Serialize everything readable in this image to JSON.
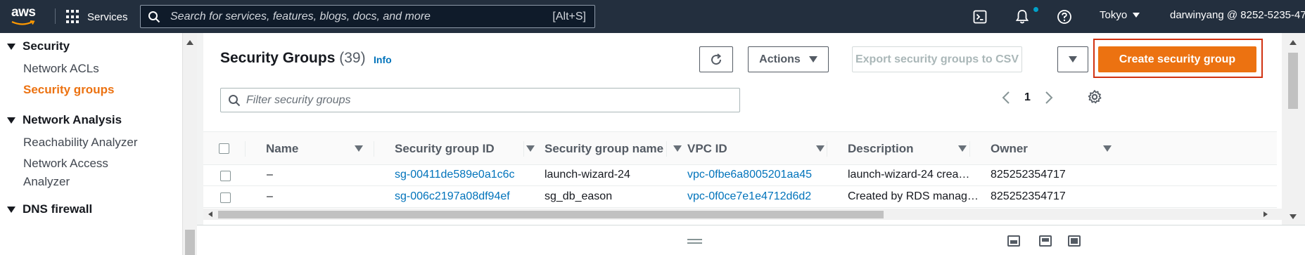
{
  "topnav": {
    "logo_text": "aws",
    "services_label": "Services",
    "search_placeholder": "Search for services, features, blogs, docs, and more",
    "search_shortcut": "[Alt+S]",
    "region": "Tokyo",
    "account": "darwinyang @ 8252-5235-47",
    "notification_dot_color": "#00a1c9"
  },
  "sidebar": {
    "sections": [
      {
        "label": "Security",
        "items": [
          "Network ACLs",
          "Security groups"
        ]
      },
      {
        "label": "Network Analysis",
        "items": [
          "Reachability Analyzer",
          "Network Access Analyzer"
        ]
      },
      {
        "label": "DNS firewall",
        "items": []
      }
    ],
    "active_item": "Security groups"
  },
  "main": {
    "title": "Security Groups",
    "count": "(39)",
    "info_label": "Info",
    "actions_label": "Actions",
    "export_label": "Export security groups to CSV",
    "create_label": "Create security group",
    "filter_placeholder": "Filter security groups",
    "page_number": "1",
    "columns": [
      "Name",
      "Security group ID",
      "Security group name",
      "VPC ID",
      "Description",
      "Owner"
    ],
    "rows": [
      {
        "name": "–",
        "sg_id": "sg-00411de589e0a1c6c",
        "sg_name": "launch-wizard-24",
        "vpc_id": "vpc-0fbe6a8005201aa45",
        "description": "launch-wizard-24 crea…",
        "owner": "825252354717"
      },
      {
        "name": "–",
        "sg_id": "sg-006c2197a08df94ef",
        "sg_name": "sg_db_eason",
        "vpc_id": "vpc-0f0ce7e1e4712d6d2",
        "description": "Created by RDS manag…",
        "owner": "825252354717"
      }
    ]
  },
  "colors": {
    "nav_bg": "#232f3e",
    "primary": "#ec7211",
    "link": "#0073bb",
    "highlight_box": "#d13212"
  }
}
